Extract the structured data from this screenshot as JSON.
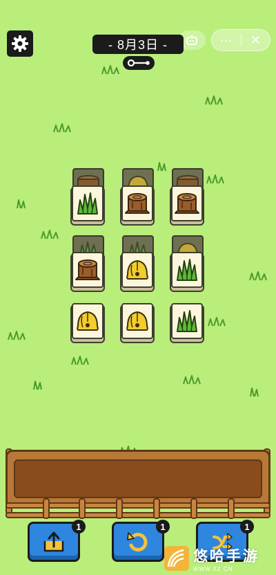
{
  "header": {
    "date_label": "- 8月3日 -",
    "capsule_more": "···",
    "capsule_close": "✕"
  },
  "board": {
    "layers": "2",
    "tiles": [
      {
        "row": 1,
        "col": 1,
        "front": "grass",
        "back": "stump"
      },
      {
        "row": 1,
        "col": 2,
        "front": "stump",
        "back": "bell"
      },
      {
        "row": 1,
        "col": 3,
        "front": "stump",
        "back": "stump"
      },
      {
        "row": 2,
        "col": 1,
        "front": "stump",
        "back": "grass"
      },
      {
        "row": 2,
        "col": 2,
        "front": "bell",
        "back": "grass"
      },
      {
        "row": 2,
        "col": 3,
        "front": "grass",
        "back": "bell"
      },
      {
        "row": 3,
        "col": 1,
        "front": "bell",
        "back": null
      },
      {
        "row": 3,
        "col": 2,
        "front": "bell",
        "back": null
      },
      {
        "row": 3,
        "col": 3,
        "front": "grass",
        "back": null
      }
    ]
  },
  "powerups": [
    {
      "name": "move-out",
      "icon": "tray-out-icon",
      "count": "1"
    },
    {
      "name": "undo",
      "icon": "undo-icon",
      "count": "1"
    },
    {
      "name": "shuffle",
      "icon": "shuffle-icon",
      "count": "1"
    }
  ],
  "watermark": {
    "title": "悠哈手游",
    "url": "WWW.XZ.CN"
  },
  "colors": {
    "background": "#b9ee7b",
    "tile_face": "#fbf6dc",
    "tray_wood": "#b87838",
    "button_blue": "#2e86de"
  }
}
